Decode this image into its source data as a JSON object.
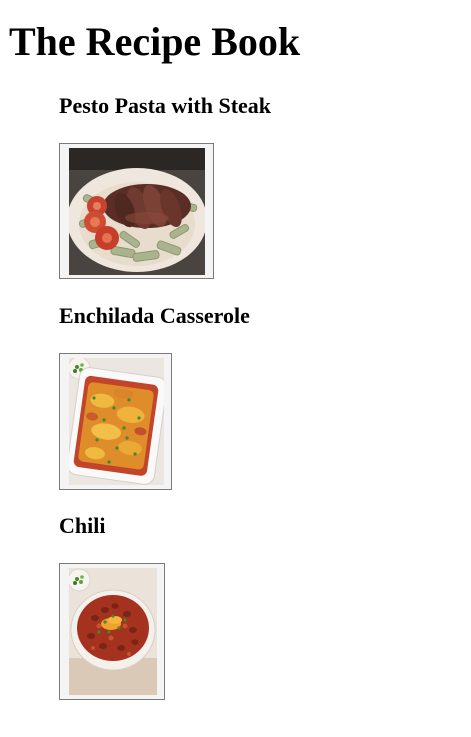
{
  "page": {
    "title": "The Recipe Book"
  },
  "recipes": [
    {
      "title": "Pesto Pasta with Steak",
      "image": "pesto-pasta-steak-photo"
    },
    {
      "title": "Enchilada Casserole",
      "image": "enchilada-casserole-photo"
    },
    {
      "title": "Chili",
      "image": "chili-bowl-photo"
    }
  ]
}
